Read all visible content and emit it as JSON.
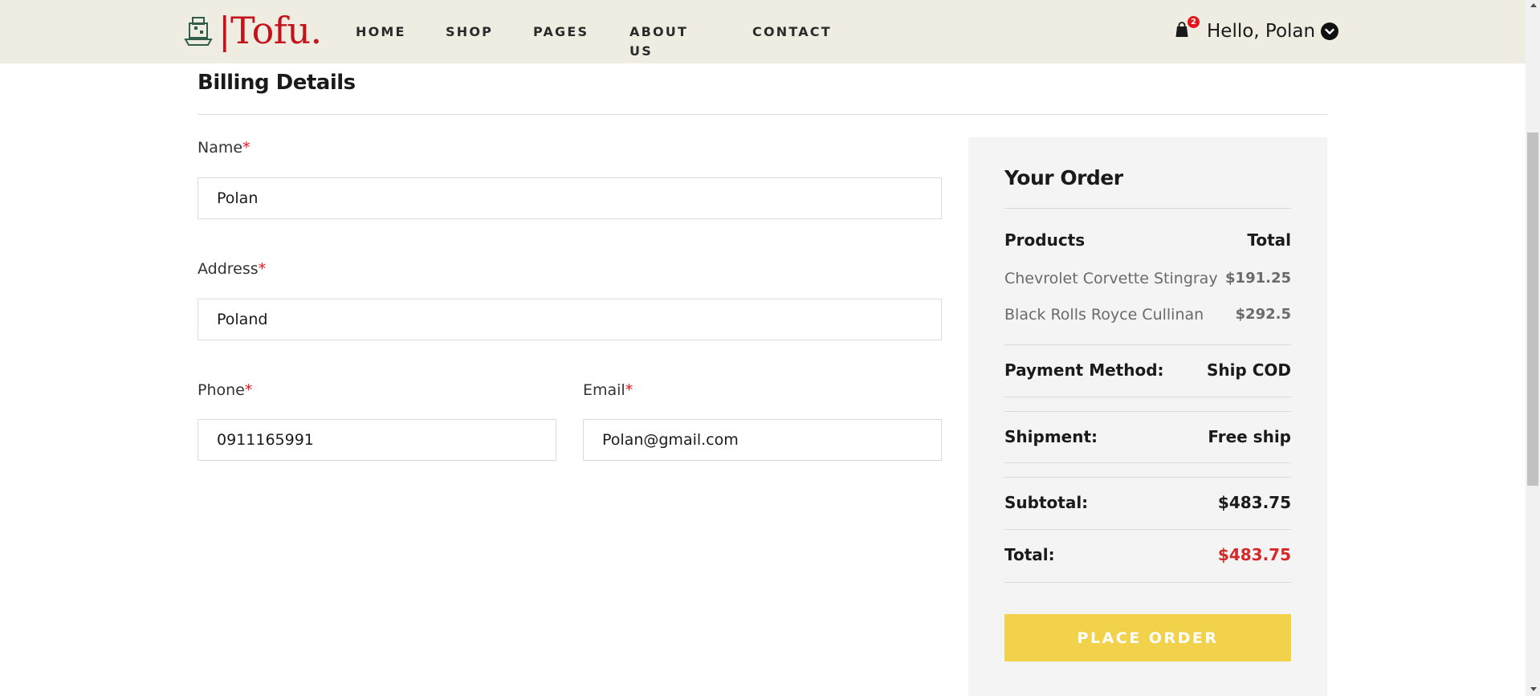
{
  "brand": {
    "name": "|Tofu.",
    "color": "#c4141b"
  },
  "nav": {
    "items": [
      "HOME",
      "SHOP",
      "PAGES",
      "ABOUT US",
      "CONTACT"
    ]
  },
  "user": {
    "greeting": "Hello, Polan",
    "cart_count": "2"
  },
  "billing": {
    "title": "Billing Details",
    "fields": {
      "name": {
        "label": "Name",
        "value": "Polan"
      },
      "address": {
        "label": "Address",
        "value": "Poland"
      },
      "phone": {
        "label": "Phone",
        "value": "0911165991"
      },
      "email": {
        "label": "Email",
        "value": "Polan@gmail.com"
      }
    },
    "required_mark": "*"
  },
  "order": {
    "title": "Your Order",
    "products_header": "Products",
    "total_header": "Total",
    "items": [
      {
        "name": "Chevrolet Corvette Stingray",
        "price": "$191.25"
      },
      {
        "name": "Black Rolls Royce Cullinan",
        "price": "$292.5"
      }
    ],
    "payment_label": "Payment Method:",
    "payment_value": "Ship COD",
    "shipment_label": "Shipment:",
    "shipment_value": "Free ship",
    "subtotal_label": "Subtotal:",
    "subtotal_value": "$483.75",
    "total_label": "Total:",
    "total_value": "$483.75",
    "place_order_label": "PLACE ORDER"
  },
  "colors": {
    "header_bg": "#efede1",
    "accent_red": "#d62828",
    "button_yellow": "#f1d24a",
    "panel_bg": "#f4f4f4"
  },
  "icons": [
    "shop-logo-icon",
    "shopping-bag-icon",
    "chevron-down-icon"
  ]
}
